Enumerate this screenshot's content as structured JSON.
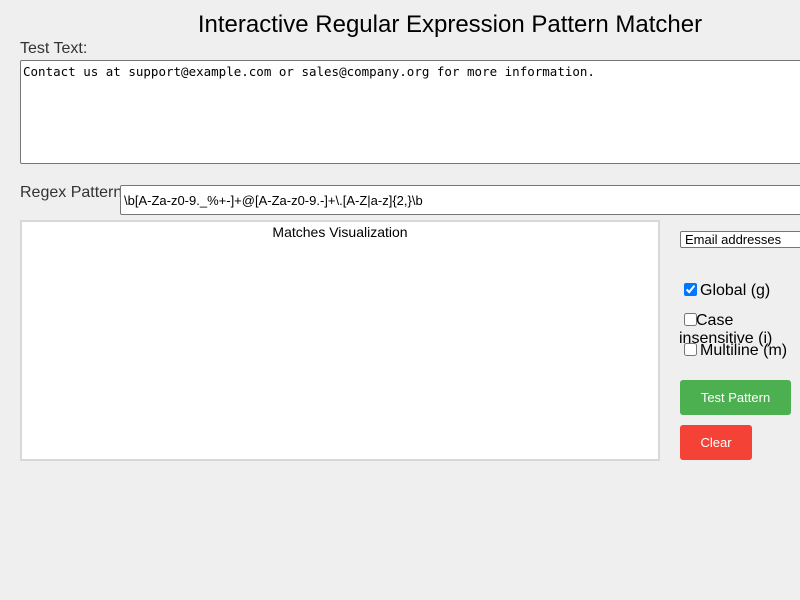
{
  "page": {
    "title": "Interactive Regular Expression Pattern Matcher"
  },
  "test_text": {
    "label": "Test Text:",
    "value": "Contact us at support@example.com or sales@company.org for more information."
  },
  "regex": {
    "label": "Regex Pattern",
    "value": "\\b[A-Za-z0-9._%+-]+@[A-Za-z0-9.-]+\\.[A-Z|a-z]{2,}\\b"
  },
  "visualization": {
    "title": "Matches Visualization"
  },
  "preset": {
    "selected": "Email addresses"
  },
  "flags": {
    "global": {
      "label": "Global (g)",
      "checked": true
    },
    "case_insensitive": {
      "label": "Case insensitive (i)",
      "checked": false
    },
    "multiline": {
      "label": "Multiline (m)",
      "checked": false
    }
  },
  "buttons": {
    "test": "Test Pattern",
    "clear": "Clear"
  },
  "colors": {
    "test_button": "#4caf50",
    "clear_button": "#f44336",
    "background": "#efefef"
  }
}
